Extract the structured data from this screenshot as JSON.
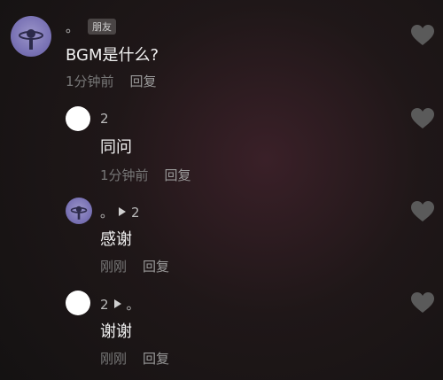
{
  "comments": [
    {
      "name": "。",
      "badge": "朋友",
      "text": "BGM是什么?",
      "time": "1分钟前",
      "reply": "回复"
    },
    {
      "name": "2",
      "text": "同问",
      "time": "1分钟前",
      "reply": "回复"
    },
    {
      "name": "。",
      "reply_to": "2",
      "text": "感谢",
      "time": "刚刚",
      "reply": "回复"
    },
    {
      "name": "2",
      "reply_to": "。",
      "text": "谢谢",
      "time": "刚刚",
      "reply": "回复"
    }
  ],
  "colors": {
    "heart": "#5a5a5a",
    "avatar_purple": "#7a73b5",
    "avatar_white": "#ffffff"
  },
  "icons": {
    "like": "heart-icon",
    "reply_arrow": "play-arrow-icon",
    "avatar_logo": "satellite-avatar-icon"
  }
}
